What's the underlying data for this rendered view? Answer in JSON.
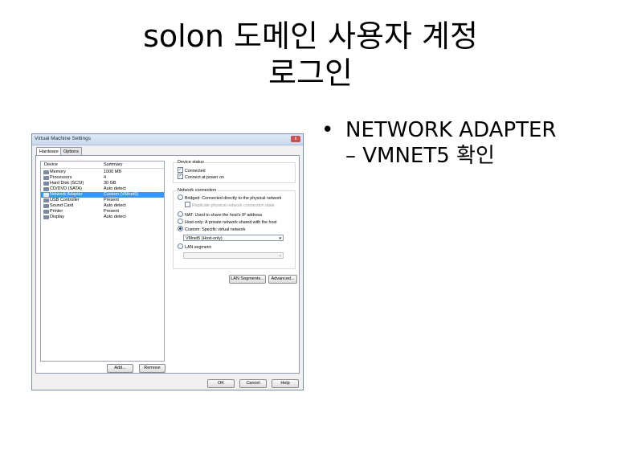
{
  "slide": {
    "title_line1": "solon 도메인 사용자 계정",
    "title_line2": "로그인",
    "bullet_symbol": "•",
    "bullet_line1": "NETWORK ADAPTER",
    "bullet_line2": "– VMNET5 확인"
  },
  "dialog": {
    "title": "Virtual Machine Settings",
    "close_glyph": "x",
    "tabs": [
      {
        "label": "Hardware",
        "active": true
      },
      {
        "label": "Options",
        "active": false
      }
    ],
    "device_list": {
      "col_device": "Device",
      "col_summary": "Summary",
      "rows": [
        {
          "device": "Memory",
          "summary": "1000 MB",
          "selected": false
        },
        {
          "device": "Processors",
          "summary": "4",
          "selected": false
        },
        {
          "device": "Hard Disk (SCSI)",
          "summary": "30 GB",
          "selected": false
        },
        {
          "device": "CD/DVD (SATA)",
          "summary": "Auto detect",
          "selected": false
        },
        {
          "device": "Network Adapter",
          "summary": "Custom (VMnet5)",
          "selected": true
        },
        {
          "device": "USB Controller",
          "summary": "Present",
          "selected": false
        },
        {
          "device": "Sound Card",
          "summary": "Auto detect",
          "selected": false
        },
        {
          "device": "Printer",
          "summary": "Present",
          "selected": false
        },
        {
          "device": "Display",
          "summary": "Auto detect",
          "selected": false
        }
      ],
      "add_label": "Add...",
      "remove_label": "Remove"
    },
    "device_status": {
      "label": "Device status",
      "connected": "Connected",
      "connect_power_on": "Connect at power on"
    },
    "network_connection": {
      "label": "Network connection",
      "bridged": "Bridged: Connected directly to the physical network",
      "replicate": "Replicate physical network connection state",
      "nat": "NAT: Used to share the host's IP address",
      "host_only": "Host-only: A private network shared with the host",
      "custom": "Custom: Specific virtual network",
      "custom_value": "VMnet5 (Host-only)",
      "lan_segment": "LAN segment:",
      "lan_value": "",
      "dropdown_glyph": "▾"
    },
    "lan_segments_button": "LAN Segments...",
    "advanced_button": "Advanced...",
    "ok_label": "OK",
    "cancel_label": "Cancel",
    "help_label": "Help"
  }
}
